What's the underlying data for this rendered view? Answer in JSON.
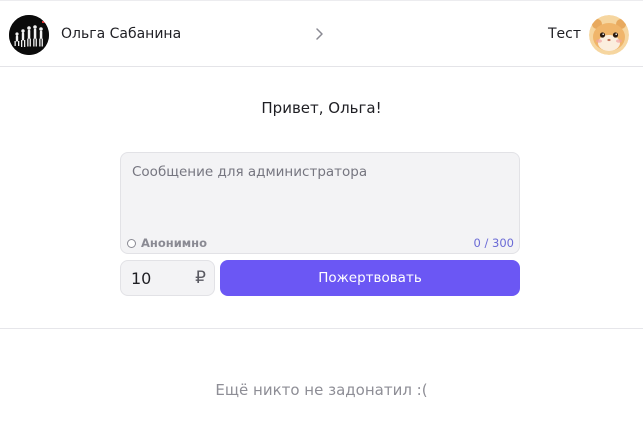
{
  "header": {
    "sender_name": "Ольга Сабанина",
    "recipient_name": "Тест",
    "sender_avatar": "evolution-silhouettes-avatar",
    "recipient_avatar": "hamster-avatar",
    "separator_icon": "chevron-right-icon"
  },
  "greeting": "Привет, Ольга!",
  "message": {
    "placeholder": "Сообщение для администратора",
    "value": "",
    "anonymous_label": "Анонимно",
    "anonymous_checked": false,
    "counter": "0 / 300"
  },
  "donation": {
    "amount": "10",
    "currency_symbol": "₽",
    "button_label": "Пожертвовать"
  },
  "donations_empty": "Ещё никто не задонатил :(",
  "colors": {
    "accent": "#6b57f4",
    "counter": "#6b6bd6",
    "input_bg": "#f3f3f5"
  }
}
